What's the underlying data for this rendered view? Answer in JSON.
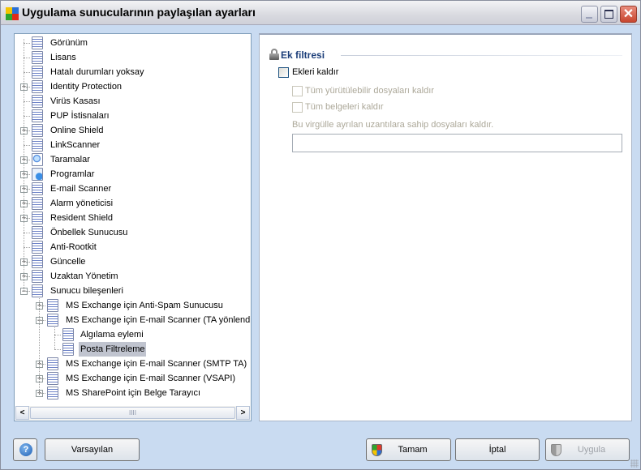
{
  "window": {
    "title": "Uygulama sunucularının paylaşılan ayarları",
    "app_icon": "avg-logo-icon",
    "controls": [
      "minimize",
      "maximize",
      "close"
    ]
  },
  "tree": {
    "items": [
      {
        "label": "Görünüm",
        "level": 0,
        "expander": null
      },
      {
        "label": "Lisans",
        "level": 0,
        "expander": null
      },
      {
        "label": "Hatalı durumları yoksay",
        "level": 0,
        "expander": null
      },
      {
        "label": "Identity Protection",
        "level": 0,
        "expander": "plus"
      },
      {
        "label": "Virüs Kasası",
        "level": 0,
        "expander": null
      },
      {
        "label": "PUP İstisnaları",
        "level": 0,
        "expander": null
      },
      {
        "label": "Online Shield",
        "level": 0,
        "expander": "plus"
      },
      {
        "label": "LinkScanner",
        "level": 0,
        "expander": null
      },
      {
        "label": "Taramalar",
        "level": 0,
        "expander": "plus",
        "icon": "scan-icon"
      },
      {
        "label": "Programlar",
        "level": 0,
        "expander": "plus",
        "icon": "schedule-icon"
      },
      {
        "label": "E-mail Scanner",
        "level": 0,
        "expander": "plus"
      },
      {
        "label": "Alarm yöneticisi",
        "level": 0,
        "expander": "plus"
      },
      {
        "label": "Resident Shield",
        "level": 0,
        "expander": "plus"
      },
      {
        "label": "Önbellek Sunucusu",
        "level": 0,
        "expander": null
      },
      {
        "label": "Anti-Rootkit",
        "level": 0,
        "expander": null
      },
      {
        "label": "Güncelle",
        "level": 0,
        "expander": "plus"
      },
      {
        "label": "Uzaktan Yönetim",
        "level": 0,
        "expander": "plus"
      },
      {
        "label": "Sunucu bileşenleri",
        "level": 0,
        "expander": "minus"
      },
      {
        "label": "MS Exchange için Anti-Spam Sunucusu",
        "level": 1,
        "expander": "plus"
      },
      {
        "label": "MS Exchange için E-mail Scanner (TA yönlendirme)",
        "level": 1,
        "expander": "minus"
      },
      {
        "label": "Algılama eylemi",
        "level": 2,
        "expander": null
      },
      {
        "label": "Posta Filtreleme",
        "level": 2,
        "expander": null,
        "selected": true
      },
      {
        "label": "MS Exchange için E-mail Scanner (SMTP TA)",
        "level": 1,
        "expander": "plus"
      },
      {
        "label": "MS Exchange için E-mail Scanner (VSAPI)",
        "level": 1,
        "expander": "plus"
      },
      {
        "label": "MS SharePoint için Belge Tarayıcı",
        "level": 1,
        "expander": "plus"
      }
    ]
  },
  "panel": {
    "section_title": "Ek filtresi",
    "remove_attachments": {
      "label": "Ekleri kaldır",
      "checked": false
    },
    "remove_executables": {
      "label": "Tüm yürütülebilir dosyaları kaldır",
      "checked": false,
      "disabled": true
    },
    "remove_documents": {
      "label": "Tüm belgeleri kaldır",
      "checked": false,
      "disabled": true
    },
    "extensions": {
      "label": "Bu virgülle ayrılan uzantılara sahip dosyaları kaldır.",
      "value": "",
      "disabled": true
    }
  },
  "buttons": {
    "help": "?",
    "defaults": "Varsayılan",
    "ok": "Tamam",
    "cancel": "İptal",
    "apply": "Uygula"
  }
}
